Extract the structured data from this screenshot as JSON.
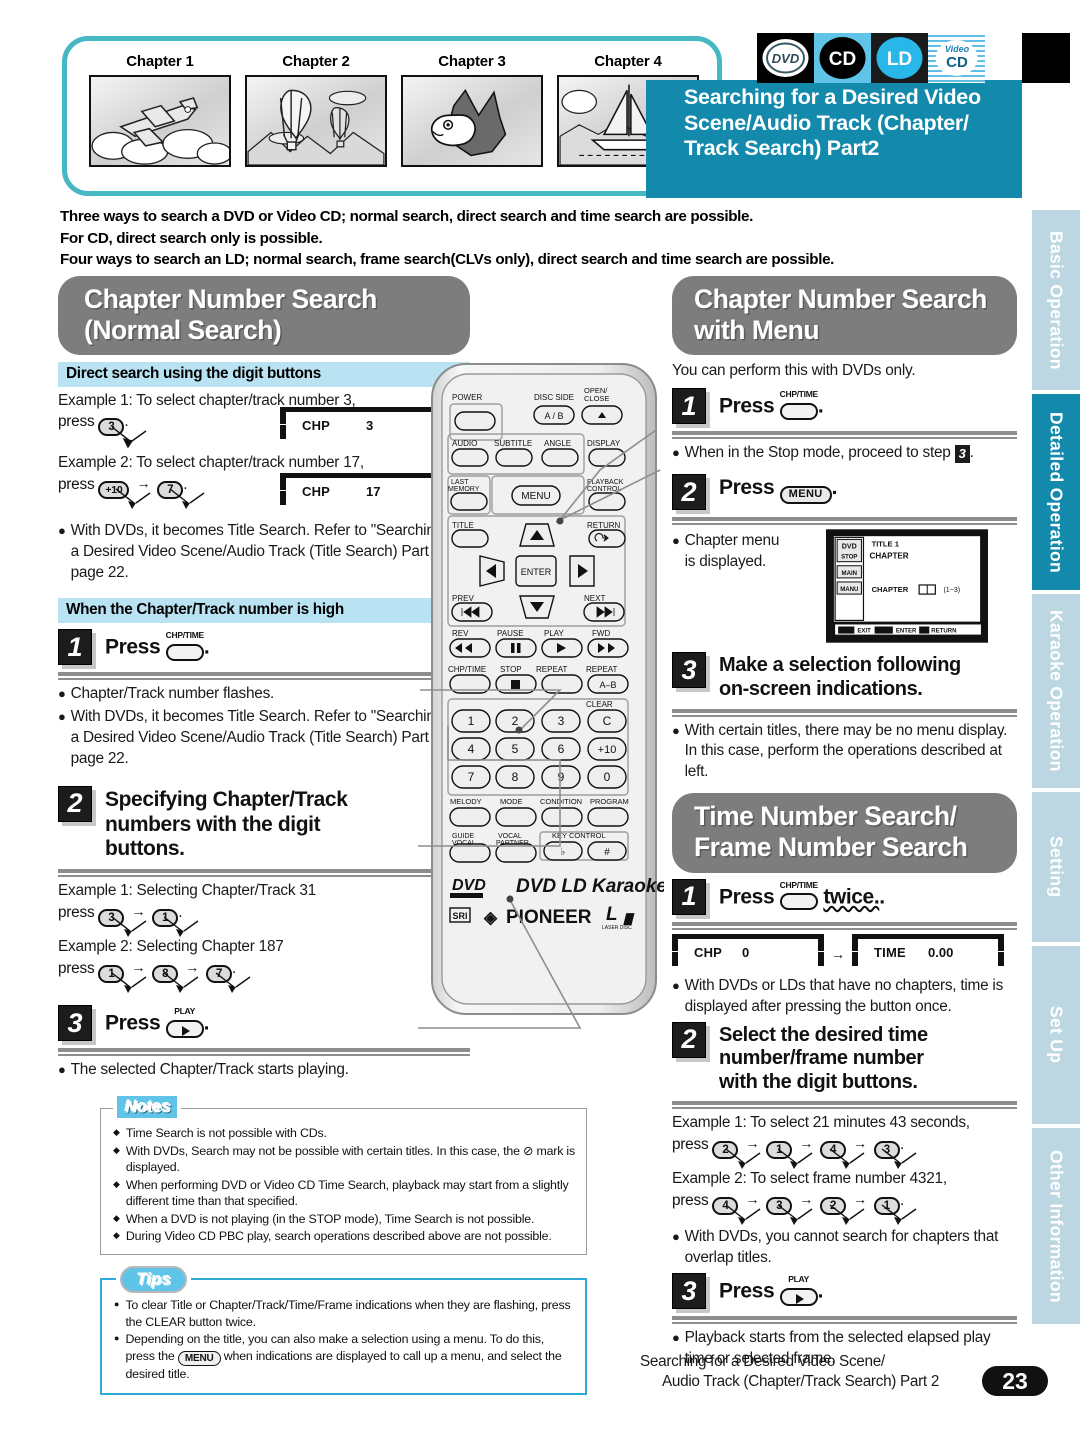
{
  "header": {
    "chapters": [
      {
        "label": "Chapter 1",
        "image": "airplane-in-clouds"
      },
      {
        "label": "Chapter 2",
        "image": "hot-air-balloons"
      },
      {
        "label": "Chapter 3",
        "image": "sunfish"
      },
      {
        "label": "Chapter 4",
        "image": "sailboat"
      }
    ],
    "disc_icons": [
      "DVD",
      "CD",
      "LD",
      "Video CD"
    ],
    "title_lines": [
      "Searching for a Desired Video",
      "Scene/Audio Track (Chapter/",
      "Track Search) Part2"
    ],
    "title_bg": "#1389ac",
    "frame_color": "#45b8c4"
  },
  "intro": [
    "Three ways to search a DVD or Video CD; normal search, direct search and time search are possible.",
    "For CD, direct search only is possible.",
    "Four ways to search an LD; normal search, frame search(CLVs only), direct search and time search are possible."
  ],
  "left": {
    "section_title_l1": "Chapter Number Search",
    "section_title_l2": "(Normal Search)",
    "subhead_1": "Direct search using the digit buttons",
    "example1_text": "Example 1: To select chapter/track number 3,",
    "example1_press": "press",
    "example1_key": "3",
    "osd1_label": "CHP",
    "osd1_value": "3",
    "example2_text": "Example 2: To select chapter/track number 17,",
    "example2_press": "press",
    "example2_key1": "+10",
    "example2_key2": "7",
    "osd2_label": "CHP",
    "osd2_value": "17",
    "bullet_1": "With DVDs, it becomes Title Search. Refer to \"Searching for a Desired Video Scene/Audio Track (Title Search) Part 1\" in page 22.",
    "subhead_2": "When the Chapter/Track number is high",
    "step1_num": "1",
    "step1_press": "Press",
    "step1_keylabel": "CHP/TIME",
    "step1_period": ".",
    "step1_b1": "Chapter/Track number flashes.",
    "step1_b2": "With DVDs, it becomes Title Search. Refer to \"Searching for a Desired Video Scene/Audio Track (Title Search) Part 1\" in page 22.",
    "step2_num": "2",
    "step2_text_l1": "Specifying Chapter/Track",
    "step2_text_l2": "numbers with the digit",
    "step2_text_l3": "buttons.",
    "ex3_text": "Example 1: Selecting Chapter/Track 31",
    "ex3_press": "press",
    "ex3_k1": "3",
    "ex3_k2": "1",
    "ex4_text": "Example 2: Selecting Chapter 187",
    "ex4_press": "press",
    "ex4_k1": "1",
    "ex4_k2": "8",
    "ex4_k3": "7",
    "step3_num": "3",
    "step3_press": "Press",
    "step3_keylabel": "PLAY",
    "step3_b1": "The selected Chapter/Track starts playing."
  },
  "right": {
    "section1_title_l1": "Chapter Number Search",
    "section1_title_l2": "with Menu",
    "intro_line": "You can perform this with DVDs only.",
    "step1_num": "1",
    "step1_press": "Press",
    "step1_keylabel": "CHP/TIME",
    "step1_b1_a": "When in the Stop mode, proceed to step",
    "step1_b1_badge": "3",
    "step2_num": "2",
    "step2_press": "Press",
    "step2_keylabel": "MENU",
    "step2_b1_l1": "Chapter menu",
    "step2_b1_l2": "is displayed.",
    "osd_menu": {
      "title": "TITLE 1",
      "heading": "CHAPTER",
      "side_items": [
        "DVD",
        "STOP",
        "MAIN",
        "MANU"
      ],
      "row_label": "CHAPTER",
      "row_range": "(1~3)",
      "footer": "MENU EXIT   ENTER ENTER   RETURN"
    },
    "step3_num": "3",
    "step3_text_l1": "Make a selection following",
    "step3_text_l2": "on-screen indications.",
    "step3_b1": "With certain titles, there may be no menu display. In this case, perform the operations described at left.",
    "section2_title_l1": "Time Number Search/",
    "section2_title_l2": "Frame Number Search",
    "t_step1_num": "1",
    "t_step1_press": "Press",
    "t_step1_keylabel": "CHP/TIME",
    "t_step1_suffix": "twice.",
    "osd_chp_label": "CHP",
    "osd_chp_value": "0",
    "osd_time_label": "TIME",
    "osd_time_value": "0.00",
    "t_b1": "With DVDs or LDs that have no chapters, time is displayed after pressing the button once.",
    "t_step2_num": "2",
    "t_step2_l1": "Select the desired time",
    "t_step2_l2": "number/frame  number",
    "t_step2_l3": "with the digit buttons.",
    "t_ex1_text": "Example 1: To select 21 minutes 43 seconds,",
    "t_ex1_press": "press",
    "t_ex1_keys": [
      "2",
      "1",
      "4",
      "3"
    ],
    "t_ex2_text": "Example 2: To select frame number 4321,",
    "t_ex2_press": "press",
    "t_ex2_keys": [
      "4",
      "3",
      "2",
      "1"
    ],
    "t_b2": "With DVDs, you cannot search for chapters that overlap titles.",
    "t_step3_num": "3",
    "t_step3_press": "Press",
    "t_step3_keylabel": "PLAY",
    "t_b3": "Playback starts from the selected elapsed play time or selected frame."
  },
  "notes": {
    "tag": "Notes",
    "items": [
      "Time Search is not possible with CDs.",
      "With DVDs, Search may not be possible with certain titles. In this case, the ⊘ mark is displayed.",
      "When performing DVD or Video CD Time Search, playback may start from a slightly different time than that specified.",
      "When a DVD is not playing (in the STOP mode), Time Search is not possible.",
      "During Video CD PBC play, search operations described above are not possible."
    ]
  },
  "tips": {
    "tag": "Tips",
    "item1": "To clear Title or Chapter/Track/Time/Frame indications when they are flashing, press the CLEAR button twice.",
    "item2_a": "Depending on the title, you can also make a selection using a menu. To do this, press the",
    "item2_key": "MENU",
    "item2_b": "when indications are displayed to call up a menu, and select the desired title."
  },
  "sidebar_tabs": [
    {
      "label": "Basic Operation",
      "active": false
    },
    {
      "label": "Detailed Operation",
      "active": true
    },
    {
      "label": "Karaoke Operation",
      "active": false
    },
    {
      "label": "Setting",
      "active": false
    },
    {
      "label": "Set Up",
      "active": false
    },
    {
      "label": "Other Information",
      "active": false
    }
  ],
  "footer": {
    "line1": "Searching for a Desired Video Scene/",
    "line2": "Audio Track  (Chapter/Track Search) Part 2",
    "page": "23"
  },
  "remote": {
    "brand": "PIONEER",
    "model_text": "DVD LD Karaoke",
    "logo_dvd": "DVD",
    "logo_sr": "SRl",
    "buttons": [
      "POWER",
      "DISC SIDE",
      "A/B",
      "OPEN/CLOSE",
      "AUDIO",
      "SUBTITLE",
      "ANGLE",
      "DISPLAY",
      "LAST MEMORY",
      "MENU",
      "PLAYBACK CONTROL",
      "TITLE",
      "RETURN",
      "ENTER",
      "PREV",
      "NEXT",
      "REV",
      "PAUSE",
      "PLAY",
      "FWD",
      "CHP/TIME",
      "STOP",
      "REPEAT",
      "REPEAT A-B",
      "CLEAR",
      "MELODY",
      "MODE",
      "CONDITION",
      "PROGRAM",
      "GUIDE VOCAL",
      "VOCAL PARTNER",
      "KEY CONTROL"
    ],
    "digits": [
      "1",
      "2",
      "3",
      "C",
      "4",
      "5",
      "6",
      "+10",
      "7",
      "8",
      "9",
      "0"
    ]
  }
}
